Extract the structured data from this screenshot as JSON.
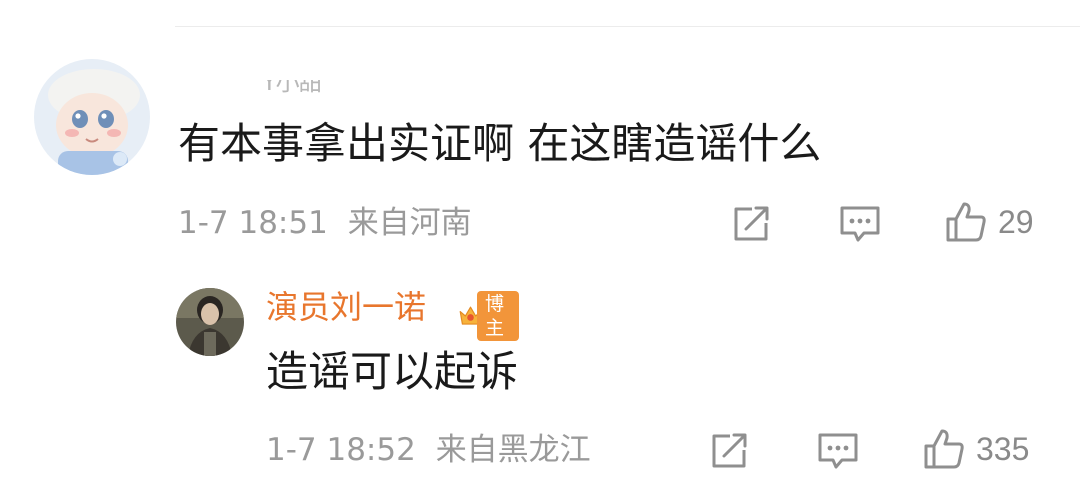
{
  "comment": {
    "username": "Y小甜",
    "text": "有本事拿出实证啊 在这瞎造谣什么",
    "time": "1-7 18:51",
    "location": "来自河南",
    "likes": "29"
  },
  "reply": {
    "username": "演员刘一诺",
    "badge": "博主",
    "text": "造谣可以起诉",
    "time": "1-7 18:52",
    "location": "来自黑龙江",
    "likes": "335"
  },
  "icons": {
    "share": "share-icon",
    "comment": "comment-icon",
    "like": "thumbs-up-icon",
    "badge": "crown-icon"
  },
  "colors": {
    "reply_name": "#e8762d",
    "badge": "#f2953a",
    "meta_text": "#9a9a9a"
  }
}
